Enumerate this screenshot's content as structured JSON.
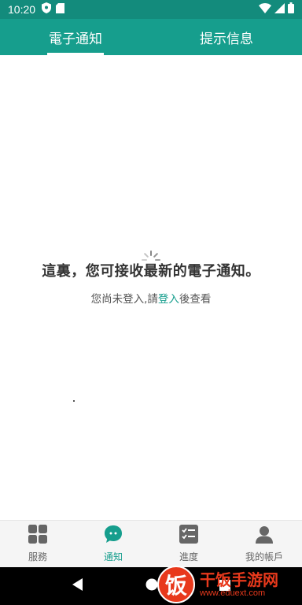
{
  "status_bar": {
    "time": "10:20",
    "icons_left": [
      "shield-icon",
      "sd-card-icon"
    ],
    "icons_right": [
      "wifi-icon",
      "signal-icon",
      "battery-icon"
    ]
  },
  "tabs": [
    {
      "label": "電子通知",
      "active": true
    },
    {
      "label": "提示信息",
      "active": false
    }
  ],
  "empty_state": {
    "title": "這裏，您可接收最新的電子通知。",
    "subtitle_prefix": "您尚未登入,請",
    "login_link": "登入",
    "subtitle_suffix": "後查看"
  },
  "bottom_nav": [
    {
      "label": "服務",
      "icon": "grid-icon",
      "active": false
    },
    {
      "label": "通知",
      "icon": "chat-bubble-icon",
      "active": true
    },
    {
      "label": "進度",
      "icon": "checklist-icon",
      "active": false
    },
    {
      "label": "我的帳戶",
      "icon": "user-icon",
      "active": false
    }
  ],
  "watermark": {
    "logo_char": "饭",
    "text": "干饭手游网",
    "url": "www.eduext.com"
  },
  "colors": {
    "primary": "#169e8d",
    "status_bar": "#138b7c",
    "watermark": "#e8391c"
  }
}
